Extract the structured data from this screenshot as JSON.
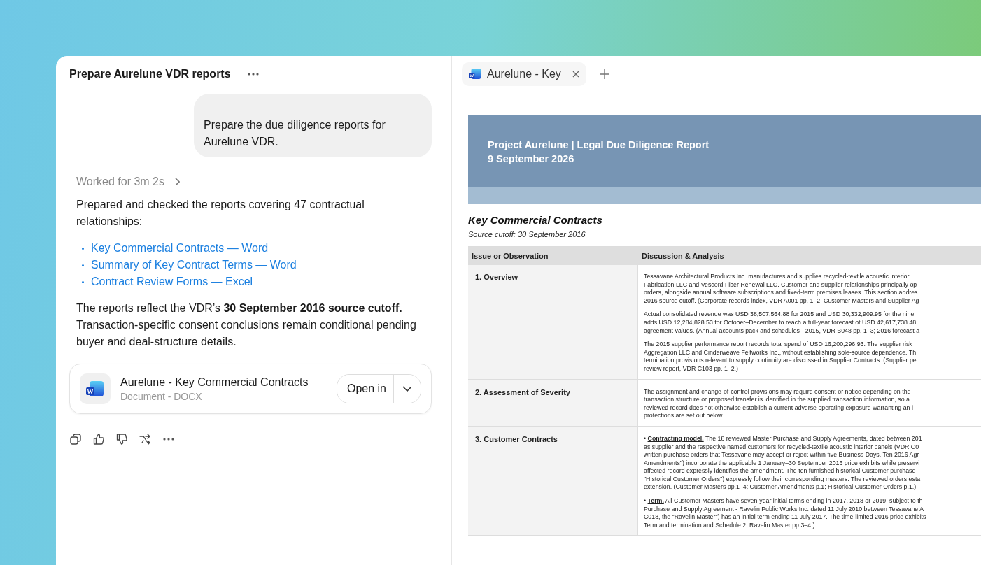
{
  "conversation": {
    "title": "Prepare Aurelune VDR reports"
  },
  "user_message": "Prepare the due diligence reports for Aurelune VDR.",
  "worked_for": "Worked for 3m 2s",
  "response": {
    "intro": "Prepared and checked the reports covering 47 contractual relationships:",
    "links": [
      "Key Commercial Contracts — Word",
      "Summary of Key Contract Terms — Word",
      "Contract Review Forms — Excel"
    ],
    "summary": "The reports reflect the VDR’s **30 September 2016 source cutoff.** Transaction-specific consent conclusions remain conditional pending buyer and deal-structure details."
  },
  "file_card": {
    "title": "Aurelune - Key Commercial Contracts",
    "subtitle": "Document - DOCX",
    "open_button": "Open in"
  },
  "tabs": [
    {
      "label": "Aurelune - Key",
      "selected": true
    }
  ],
  "document": {
    "banner_title": "Project Aurelune | Legal Due Diligence Report",
    "banner_date": "9 September 2026",
    "section_title": "Key Commercial Contracts",
    "source_note": "Source cutoff: 30 September 2016",
    "table": {
      "columns": [
        "Issue or Observation",
        "Discussion & Analysis"
      ],
      "rows": [
        {
          "issue": "1. Overview",
          "paragraphs": [
            "Tessavane Architectural Products Inc. manufactures and supplies recycled-textile acoustic interior\nFabrication LLC and Vescord Fiber Renewal LLC. Customer and supplier relationships principally op\norders, alongside annual software subscriptions and fixed-term premises leases. This section addres\n2016 source cutoff. (Corporate records index, VDR A001 pp. 1–2; Customer Masters and Supplier Ag",
            "Actual consolidated revenue was USD 38,507,564.88 for 2015 and USD 30,332,909.95 for the nine\nadds USD 12,284,828.53 for October–December to reach a full-year forecast of USD 42,617,738.48.\nagreement values. (Annual accounts pack and schedules - 2015, VDR B048 pp. 1–3; 2016 forecast a",
            "The 2015 supplier performance report records total spend of USD 16,200,296.93. The supplier risk\nAggregation LLC and Cinderweave Feltworks Inc., without establishing sole-source dependence. Th\ntermination provisions relevant to supply continuity are discussed in Supplier Contracts. (Supplier pe\nreview report, VDR C103 pp. 1–2.)"
          ]
        },
        {
          "issue": "2. Assessment of Severity",
          "paragraphs": [
            "The assignment and change-of-control provisions may require consent or notice depending on the\ntransaction structure or proposed transfer is identified in the supplied transaction information, so a\nreviewed record does not otherwise establish a current adverse operating exposure warranting an i\nprotections are set out below."
          ]
        },
        {
          "issue": "3. Customer Contracts",
          "paragraphs": [
            "• **Contracting model.** The 18 reviewed Master Purchase and Supply Agreements, dated between 201\nas supplier and the respective named customers for recycled-textile acoustic interior panels (VDR C0\nwritten purchase orders that Tessavane may accept or reject within five Business Days. Ten 2016 Agr\nAmendments\") incorporate the applicable 1 January–30 September 2016 price exhibits while preservi\naffected record expressly identifies the amendment. The ten furnished historical Customer purchase\n\"Historical Customer Orders\") expressly follow their corresponding masters. The reviewed orders esta\nextension. (Customer Masters pp.1–4; Customer Amendments p.1; Historical Customer Orders p.1.)",
            "• **Term.** All Customer Masters have seven-year initial terms ending in 2017, 2018 or 2019, subject to th\nPurchase and Supply Agreement - Ravelin Public Works Inc. dated 11 July 2010 between Tessavane A\nC018, the \"Ravelin Master\") has an initial term ending 11 July 2017. The time-limited 2016 price exhibits\nTerm and termination and Schedule 2; Ravelin Master pp.3–4.)"
          ]
        }
      ]
    }
  }
}
